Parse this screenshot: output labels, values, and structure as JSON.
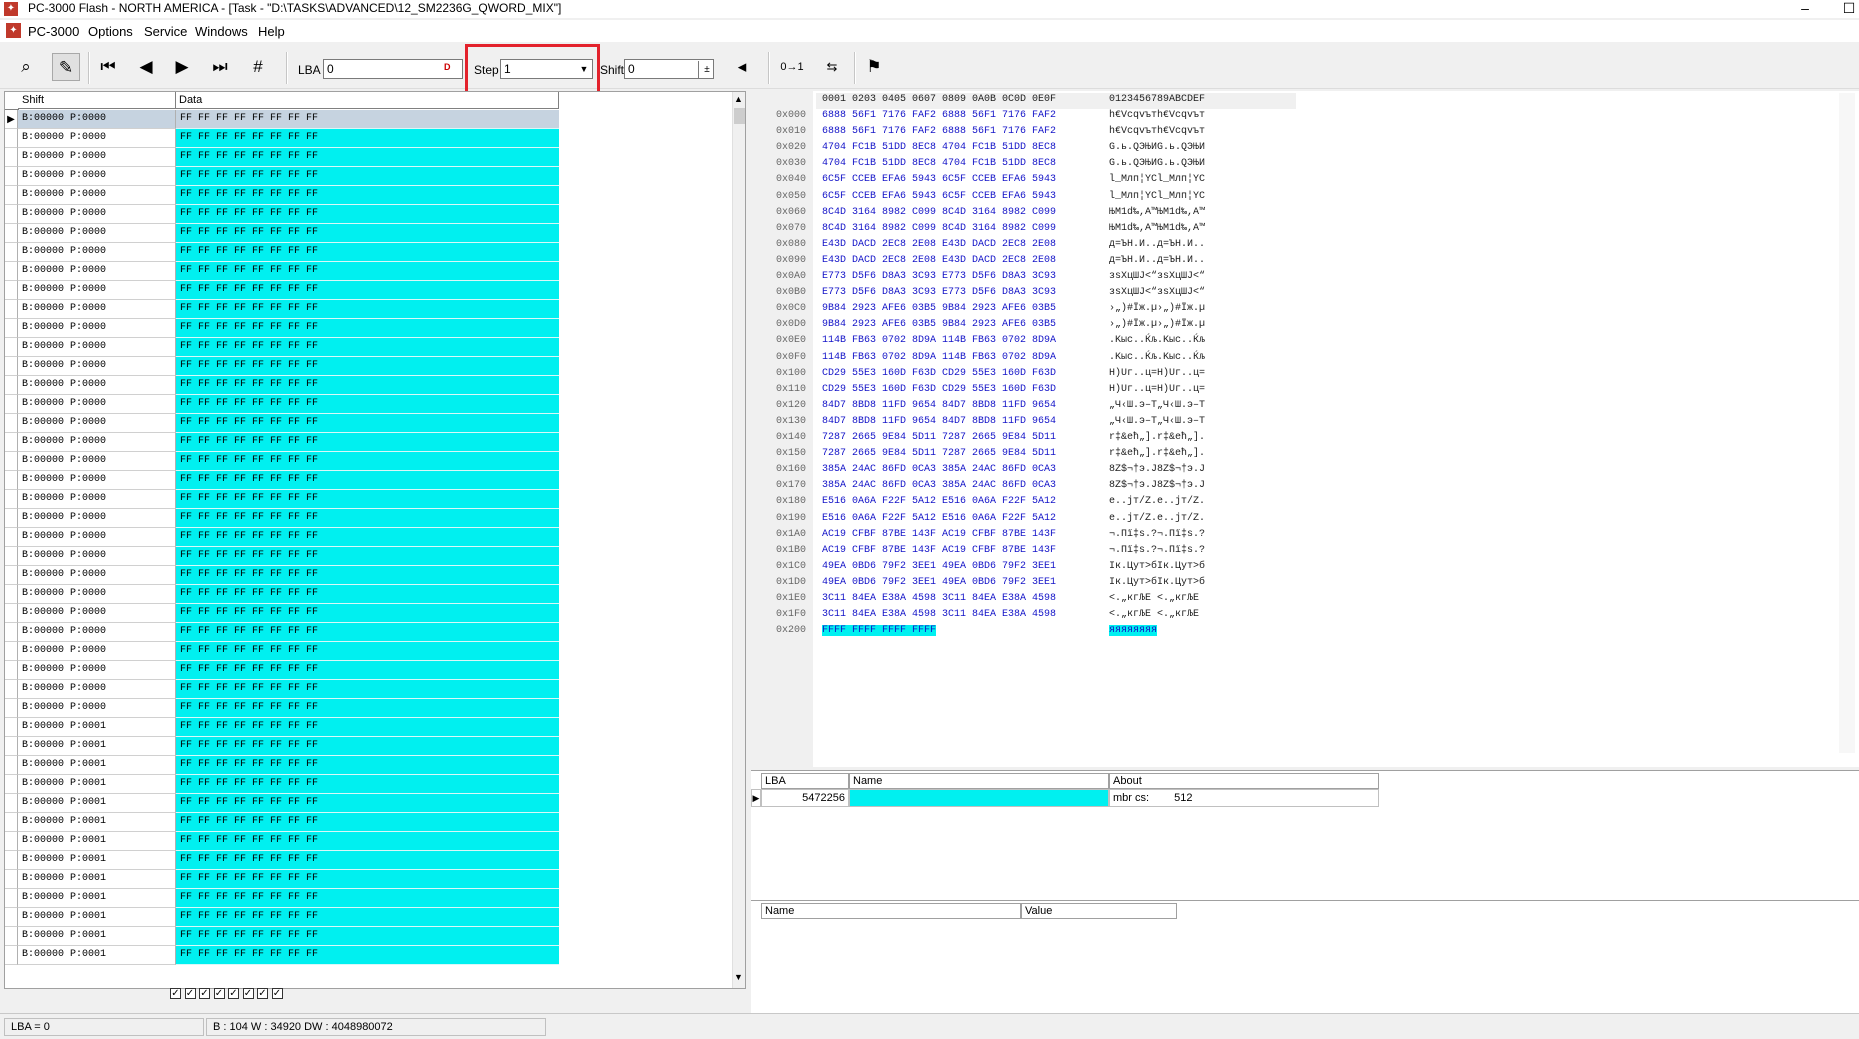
{
  "window": {
    "title": "PC-3000 Flash - NORTH AMERICA - [Task - \"D:\\TASKS\\ADVANCED\\12_SM2236G_QWORD_MIX\"]",
    "min_label": "–",
    "max_label": "☐"
  },
  "menu": {
    "items": [
      "PC-3000",
      "Options",
      "Service",
      "Windows",
      "Help"
    ]
  },
  "toolbar": {
    "lba_label": "LBA",
    "lba_value": "0",
    "lba_radix": "D",
    "step_label": "Step",
    "step_value": "1",
    "shift_label": "Shift",
    "shift_value": "0",
    "icons": [
      "binoculars-icon",
      "edit-icon",
      "first-page-icon",
      "prev-page-icon",
      "next-page-icon",
      "last-page-icon",
      "goto-number-icon",
      "calc-icon",
      "prev-arrow-icon",
      "swap-bits-icon",
      "byte-swap-icon",
      "run-icon"
    ]
  },
  "grid": {
    "col_shift": "Shift",
    "col_data": "Data",
    "rows": [
      {
        "shift": "B:00000 P:0000",
        "data": "FF FF FF FF FF FF FF FF"
      },
      {
        "shift": "B:00000 P:0000",
        "data": "FF FF FF FF FF FF FF FF"
      },
      {
        "shift": "B:00000 P:0000",
        "data": "FF FF FF FF FF FF FF FF"
      },
      {
        "shift": "B:00000 P:0000",
        "data": "FF FF FF FF FF FF FF FF"
      },
      {
        "shift": "B:00000 P:0000",
        "data": "FF FF FF FF FF FF FF FF"
      },
      {
        "shift": "B:00000 P:0000",
        "data": "FF FF FF FF FF FF FF FF"
      },
      {
        "shift": "B:00000 P:0000",
        "data": "FF FF FF FF FF FF FF FF"
      },
      {
        "shift": "B:00000 P:0000",
        "data": "FF FF FF FF FF FF FF FF"
      },
      {
        "shift": "B:00000 P:0000",
        "data": "FF FF FF FF FF FF FF FF"
      },
      {
        "shift": "B:00000 P:0000",
        "data": "FF FF FF FF FF FF FF FF"
      },
      {
        "shift": "B:00000 P:0000",
        "data": "FF FF FF FF FF FF FF FF"
      },
      {
        "shift": "B:00000 P:0000",
        "data": "FF FF FF FF FF FF FF FF"
      },
      {
        "shift": "B:00000 P:0000",
        "data": "FF FF FF FF FF FF FF FF"
      },
      {
        "shift": "B:00000 P:0000",
        "data": "FF FF FF FF FF FF FF FF"
      },
      {
        "shift": "B:00000 P:0000",
        "data": "FF FF FF FF FF FF FF FF"
      },
      {
        "shift": "B:00000 P:0000",
        "data": "FF FF FF FF FF FF FF FF"
      },
      {
        "shift": "B:00000 P:0000",
        "data": "FF FF FF FF FF FF FF FF"
      },
      {
        "shift": "B:00000 P:0000",
        "data": "FF FF FF FF FF FF FF FF"
      },
      {
        "shift": "B:00000 P:0000",
        "data": "FF FF FF FF FF FF FF FF"
      },
      {
        "shift": "B:00000 P:0000",
        "data": "FF FF FF FF FF FF FF FF"
      },
      {
        "shift": "B:00000 P:0000",
        "data": "FF FF FF FF FF FF FF FF"
      },
      {
        "shift": "B:00000 P:0000",
        "data": "FF FF FF FF FF FF FF FF"
      },
      {
        "shift": "B:00000 P:0000",
        "data": "FF FF FF FF FF FF FF FF"
      },
      {
        "shift": "B:00000 P:0000",
        "data": "FF FF FF FF FF FF FF FF"
      },
      {
        "shift": "B:00000 P:0000",
        "data": "FF FF FF FF FF FF FF FF"
      },
      {
        "shift": "B:00000 P:0000",
        "data": "FF FF FF FF FF FF FF FF"
      },
      {
        "shift": "B:00000 P:0000",
        "data": "FF FF FF FF FF FF FF FF"
      },
      {
        "shift": "B:00000 P:0000",
        "data": "FF FF FF FF FF FF FF FF"
      },
      {
        "shift": "B:00000 P:0000",
        "data": "FF FF FF FF FF FF FF FF"
      },
      {
        "shift": "B:00000 P:0000",
        "data": "FF FF FF FF FF FF FF FF"
      },
      {
        "shift": "B:00000 P:0000",
        "data": "FF FF FF FF FF FF FF FF"
      },
      {
        "shift": "B:00000 P:0000",
        "data": "FF FF FF FF FF FF FF FF"
      },
      {
        "shift": "B:00000 P:0001",
        "data": "FF FF FF FF FF FF FF FF"
      },
      {
        "shift": "B:00000 P:0001",
        "data": "FF FF FF FF FF FF FF FF"
      },
      {
        "shift": "B:00000 P:0001",
        "data": "FF FF FF FF FF FF FF FF"
      },
      {
        "shift": "B:00000 P:0001",
        "data": "FF FF FF FF FF FF FF FF"
      },
      {
        "shift": "B:00000 P:0001",
        "data": "FF FF FF FF FF FF FF FF"
      },
      {
        "shift": "B:00000 P:0001",
        "data": "FF FF FF FF FF FF FF FF"
      },
      {
        "shift": "B:00000 P:0001",
        "data": "FF FF FF FF FF FF FF FF"
      },
      {
        "shift": "B:00000 P:0001",
        "data": "FF FF FF FF FF FF FF FF"
      },
      {
        "shift": "B:00000 P:0001",
        "data": "FF FF FF FF FF FF FF FF"
      },
      {
        "shift": "B:00000 P:0001",
        "data": "FF FF FF FF FF FF FF FF"
      },
      {
        "shift": "B:00000 P:0001",
        "data": "FF FF FF FF FF FF FF FF"
      },
      {
        "shift": "B:00000 P:0001",
        "data": "FF FF FF FF FF FF FF FF"
      },
      {
        "shift": "B:00000 P:0001",
        "data": "FF FF FF FF FF FF FF FF"
      }
    ],
    "checkboxes": [
      "✓",
      "✓",
      "✓",
      "✓",
      "✓",
      "✓",
      "✓",
      "✓"
    ]
  },
  "hex": {
    "header_hex": "0001 0203 0405 0607 0809 0A0B 0C0D 0E0F",
    "header_ascii": "0123456789ABCDEF",
    "rows": [
      {
        "off": "0x000",
        "hex": "6888 56F1 7176 FAF2 6888 56F1 7176 FAF2",
        "asc": "h€Vcqvътh€Vcqvът"
      },
      {
        "off": "0x010",
        "hex": "6888 56F1 7176 FAF2 6888 56F1 7176 FAF2",
        "asc": "h€Vcqvътh€Vcqvът"
      },
      {
        "off": "0x020",
        "hex": "4704 FC1B 51DD 8EC8 4704 FC1B 51DD 8EC8",
        "asc": "G.ь.QЭЊИG.ь.QЭЊИ"
      },
      {
        "off": "0x030",
        "hex": "4704 FC1B 51DD 8EC8 4704 FC1B 51DD 8EC8",
        "asc": "G.ь.QЭЊИG.ь.QЭЊИ"
      },
      {
        "off": "0x040",
        "hex": "6C5F CCEB EFA6 5943 6C5F CCEB EFA6 5943",
        "asc": "l_Млп¦YCl_Млп¦YC"
      },
      {
        "off": "0x050",
        "hex": "6C5F CCEB EFA6 5943 6C5F CCEB EFA6 5943",
        "asc": "l_Млп¦YCl_Млп¦YC"
      },
      {
        "off": "0x060",
        "hex": "8C4D 3164 8982 C099 8C4D 3164 8982 C099",
        "asc": "ЊM1d‰,А™ЊM1d‰,А™"
      },
      {
        "off": "0x070",
        "hex": "8C4D 3164 8982 C099 8C4D 3164 8982 C099",
        "asc": "ЊM1d‰,А™ЊM1d‰,А™"
      },
      {
        "off": "0x080",
        "hex": "E43D DACD 2EC8 2E08 E43D DACD 2EC8 2E08",
        "asc": "д=ЪН.И..д=ЪН.И.."
      },
      {
        "off": "0x090",
        "hex": "E43D DACD 2EC8 2E08 E43D DACD 2EC8 2E08",
        "asc": "д=ЪН.И..д=ЪН.И.."
      },
      {
        "off": "0x0A0",
        "hex": "E773 D5F6 D8A3 3C93 E773 D5F6 D8A3 3C93",
        "asc": "зsХцШЈ<“зsХцШЈ<“"
      },
      {
        "off": "0x0B0",
        "hex": "E773 D5F6 D8A3 3C93 E773 D5F6 D8A3 3C93",
        "asc": "зsХцШЈ<“зsХцШЈ<“"
      },
      {
        "off": "0x0C0",
        "hex": "9B84 2923 AFE6 03B5 9B84 2923 AFE6 03B5",
        "asc": "›„)#Їж.µ›„)#Їж.µ"
      },
      {
        "off": "0x0D0",
        "hex": "9B84 2923 AFE6 03B5 9B84 2923 AFE6 03B5",
        "asc": "›„)#Їж.µ›„)#Їж.µ"
      },
      {
        "off": "0x0E0",
        "hex": "114B FB63 0702 8D9A 114B FB63 0702 8D9A",
        "asc": ".Kыc..Ќљ.Kыc..Ќљ"
      },
      {
        "off": "0x0F0",
        "hex": "114B FB63 0702 8D9A 114B FB63 0702 8D9A",
        "asc": ".Kыc..Ќљ.Kыc..Ќљ"
      },
      {
        "off": "0x100",
        "hex": "CD29 55E3 160D F63D CD29 55E3 160D F63D",
        "asc": "Н)Uг..ц=Н)Uг..ц="
      },
      {
        "off": "0x110",
        "hex": "CD29 55E3 160D F63D CD29 55E3 160D F63D",
        "asc": "Н)Uг..ц=Н)Uг..ц="
      },
      {
        "off": "0x120",
        "hex": "84D7 8BD8 11FD 9654 84D7 8BD8 11FD 9654",
        "asc": "„Ч‹Ш.э–T„Ч‹Ш.э–T"
      },
      {
        "off": "0x130",
        "hex": "84D7 8BD8 11FD 9654 84D7 8BD8 11FD 9654",
        "asc": "„Ч‹Ш.э–T„Ч‹Ш.э–T"
      },
      {
        "off": "0x140",
        "hex": "7287 2665 9E84 5D11 7287 2665 9E84 5D11",
        "asc": "r‡&eћ„].r‡&eћ„]."
      },
      {
        "off": "0x150",
        "hex": "7287 2665 9E84 5D11 7287 2665 9E84 5D11",
        "asc": "r‡&eћ„].r‡&eћ„]."
      },
      {
        "off": "0x160",
        "hex": "385A 24AC 86FD 0CA3 385A 24AC 86FD 0CA3",
        "asc": "8Z$¬†э.J8Z$¬†э.J"
      },
      {
        "off": "0x170",
        "hex": "385A 24AC 86FD 0CA3 385A 24AC 86FD 0CA3",
        "asc": "8Z$¬†э.J8Z$¬†э.J"
      },
      {
        "off": "0x180",
        "hex": "E516 0A6A F22F 5A12 E516 0A6A F22F 5A12",
        "asc": "е..jт/Z.е..jт/Z."
      },
      {
        "off": "0x190",
        "hex": "E516 0A6A F22F 5A12 E516 0A6A F22F 5A12",
        "asc": "е..jт/Z.е..jт/Z."
      },
      {
        "off": "0x1A0",
        "hex": "AC19 CFBF 87BE 143F AC19 CFBF 87BE 143F",
        "asc": "¬.Пї‡s.?¬.Пї‡s.?"
      },
      {
        "off": "0x1B0",
        "hex": "AC19 CFBF 87BE 143F AC19 CFBF 87BE 143F",
        "asc": "¬.Пї‡s.?¬.Пї‡s.?"
      },
      {
        "off": "0x1C0",
        "hex": "49EA 0BD6 79F2 3EE1 49EA 0BD6 79F2 3EE1",
        "asc": "Iк.Цyт>бIк.Цyт>б"
      },
      {
        "off": "0x1D0",
        "hex": "49EA 0BD6 79F2 3EE1 49EA 0BD6 79F2 3EE1",
        "asc": "Iк.Цyт>бIк.Цyт>б"
      },
      {
        "off": "0x1E0",
        "hex": "3C11 84EA E38A 4598 3C11 84EA E38A 4598",
        "asc": "<.„кгЉE <.„кгЉE"
      },
      {
        "off": "0x1F0",
        "hex": "3C11 84EA E38A 4598 3C11 84EA E38A 4598",
        "asc": "<.„кгЉE <.„кгЉE"
      }
    ],
    "tail_off": "0x200",
    "tail_hex": "FFFF FFFF FFFF FFFF",
    "tail_asc": "яяяяяяяя"
  },
  "lba_table": {
    "col_lba": "LBA",
    "col_name": "Name",
    "col_about": "About",
    "row": {
      "lba": "5472256",
      "name": "",
      "about_label": "mbr cs:",
      "about_value": "512"
    }
  },
  "nv_table": {
    "col_name": "Name",
    "col_value": "Value"
  },
  "status": {
    "lba": "LBA =    0",
    "info": "B : 104 W : 34920 DW : 4048980072"
  },
  "colors": {
    "data_cell": "#00f0f0",
    "hex_blue": "#1414c8",
    "highlight_red": "#e3222c"
  }
}
